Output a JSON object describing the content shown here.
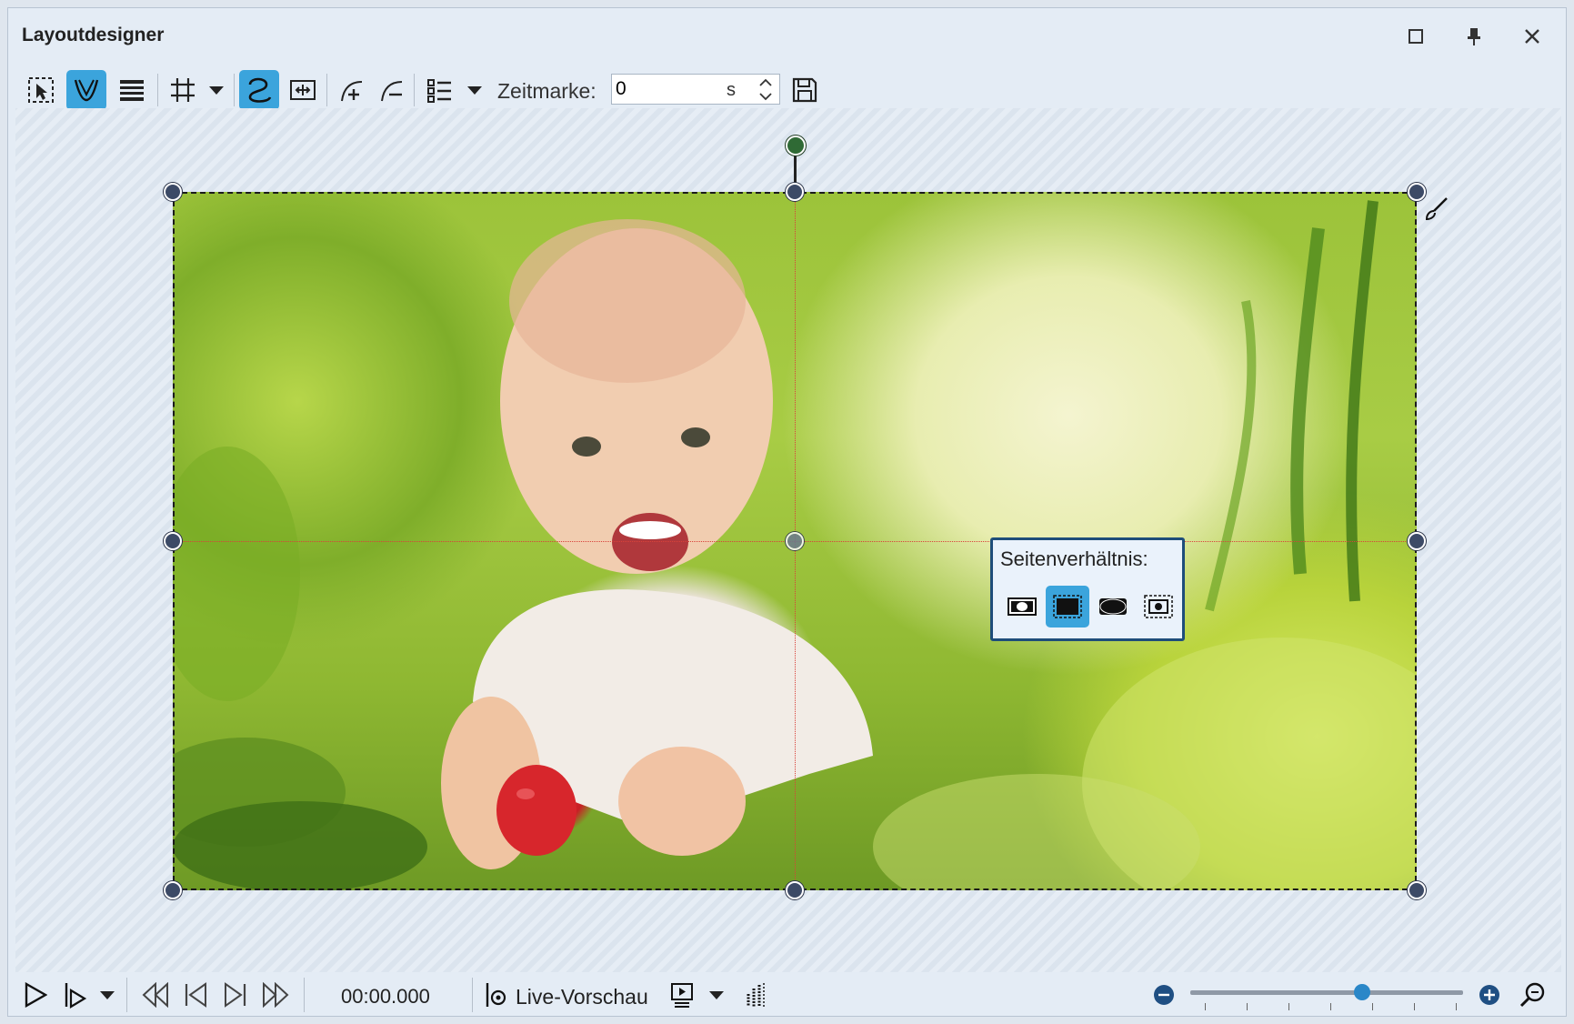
{
  "window": {
    "title": "Layoutdesigner"
  },
  "toolbar": {
    "zeitmarke_label": "Zeitmarke:",
    "zeitmarke_value": "0",
    "zeitmarke_unit": "s"
  },
  "popup": {
    "title": "Seitenverhältnis:",
    "selected_index": 1
  },
  "playback": {
    "timecode": "00:00.000",
    "live_preview_label": "Live-Vorschau",
    "zoom_level": 0.63
  },
  "colors": {
    "accent": "#3ba4dc",
    "handle": "#3c4a66",
    "rotation_handle": "#2f6a35",
    "guide": "#d9423a",
    "popup_border": "#1e4d7a"
  }
}
